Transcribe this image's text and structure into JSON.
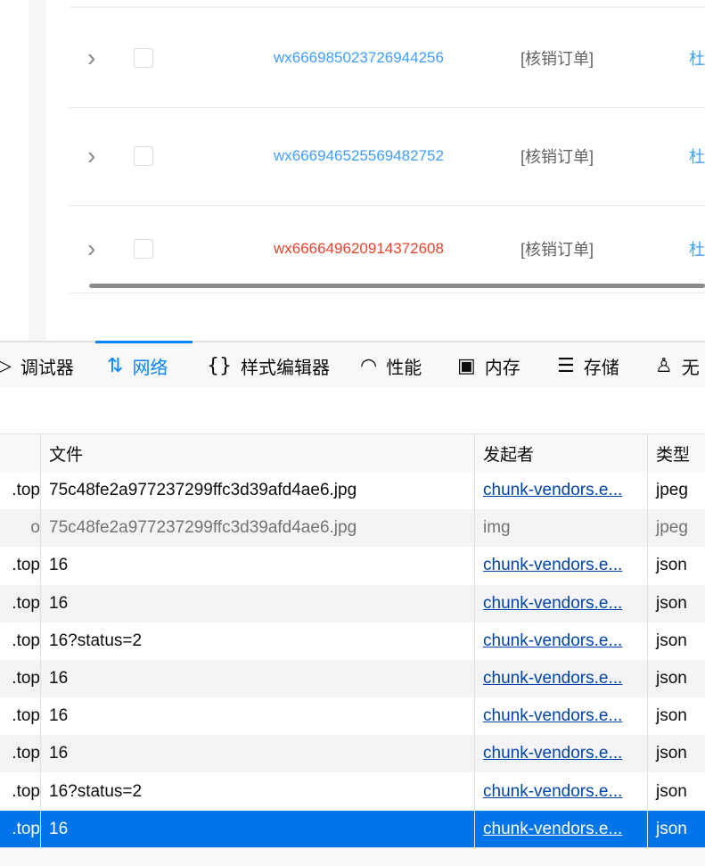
{
  "orders": [
    {
      "id": "wx666985023726944256",
      "type": "[核销订单]",
      "user": "杜",
      "id_color": "#409eff"
    },
    {
      "id": "wx666946525569482752",
      "type": "[核销订单]",
      "user": "杜",
      "id_color": "#409eff"
    },
    {
      "id": "wx666649620914372608",
      "type": "[核销订单]",
      "user": "杜",
      "id_color": "#e6452c"
    }
  ],
  "devtools": {
    "tabs": [
      {
        "label": "调试器",
        "icon": "debugger-icon",
        "glyph": "▷"
      },
      {
        "label": "网络",
        "icon": "network-icon",
        "glyph": "⇅"
      },
      {
        "label": "样式编辑器",
        "icon": "style-editor-icon",
        "glyph": "{}"
      },
      {
        "label": "性能",
        "icon": "performance-icon",
        "glyph": "◠"
      },
      {
        "label": "内存",
        "icon": "memory-icon",
        "glyph": "▣"
      },
      {
        "label": "存储",
        "icon": "storage-icon",
        "glyph": "☰"
      },
      {
        "label": "无",
        "icon": "accessibility-icon",
        "glyph": "♙"
      }
    ],
    "active_tab": "网络"
  },
  "network": {
    "columns": {
      "file": "文件",
      "initiator": "发起者",
      "type": "类型"
    },
    "rows": [
      {
        "domain": ".top",
        "file": "75c48fe2a977237299ffc3d39afd4ae6.jpg",
        "initiator": "chunk-vendors.e...",
        "type": "jpeg"
      },
      {
        "domain": "o",
        "file": "75c48fe2a977237299ffc3d39afd4ae6.jpg",
        "initiator": "img",
        "type": "jpeg"
      },
      {
        "domain": ".top",
        "file": "16",
        "initiator": "chunk-vendors.e...",
        "type": "json"
      },
      {
        "domain": ".top",
        "file": "16",
        "initiator": "chunk-vendors.e...",
        "type": "json"
      },
      {
        "domain": ".top",
        "file": "16?status=2",
        "initiator": "chunk-vendors.e...",
        "type": "json"
      },
      {
        "domain": ".top",
        "file": "16",
        "initiator": "chunk-vendors.e...",
        "type": "json"
      },
      {
        "domain": ".top",
        "file": "16",
        "initiator": "chunk-vendors.e...",
        "type": "json"
      },
      {
        "domain": ".top",
        "file": "16",
        "initiator": "chunk-vendors.e...",
        "type": "json"
      },
      {
        "domain": ".top",
        "file": "16?status=2",
        "initiator": "chunk-vendors.e...",
        "type": "json"
      },
      {
        "domain": ".top",
        "file": "16",
        "initiator": "chunk-vendors.e...",
        "type": "json"
      }
    ]
  },
  "colors": {
    "accent": "#0a84ff",
    "selected_row": "#0074e8",
    "link": "#409eff",
    "alert_link": "#e6452c"
  }
}
